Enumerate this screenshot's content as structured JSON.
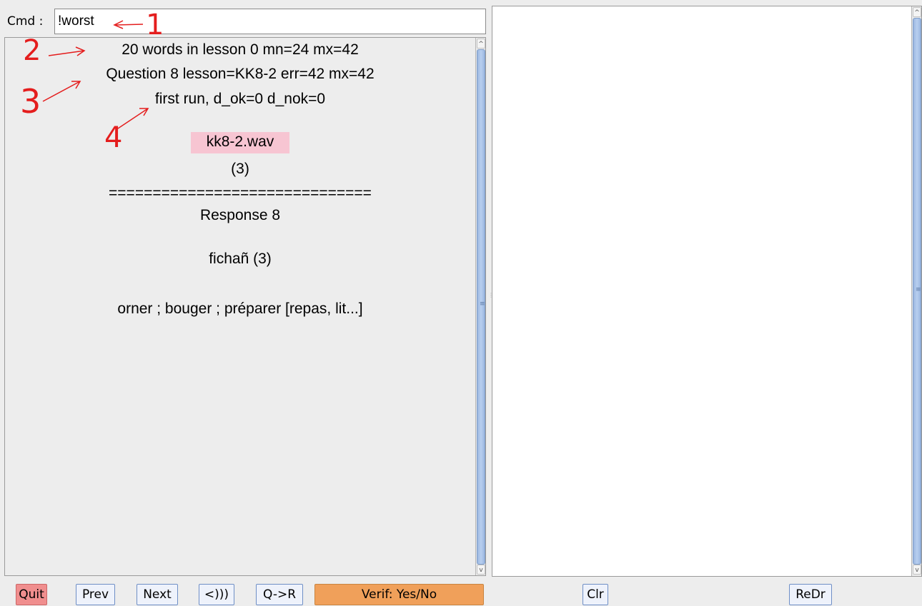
{
  "left": {
    "cmd_label": "Cmd :",
    "cmd_value": "!worst",
    "lesson": {
      "line1": "20  words in lesson  0 mn=24 mx=42",
      "line2": "Question  8   lesson=KK8-2   err=42   mx=42",
      "line3": "first run, d_ok=0   d_nok=0",
      "audio_file": "kk8-2.wav",
      "count_q": "(3)",
      "separator": "==============================",
      "response": "Response  8",
      "word": "fichañ  (3)",
      "meaning": "orner ; bouger ; préparer [repas, lit...]"
    },
    "toolbar": {
      "quit": "Quit",
      "prev": "Prev",
      "next": "Next",
      "play": "<)))",
      "q_to_r": "Q->R",
      "verif": "Verif: Yes/No"
    }
  },
  "right": {
    "toolbar": {
      "clr": "Clr",
      "redr": "ReDr"
    }
  },
  "annotations": {
    "labels": [
      "1",
      "2",
      "3",
      "4"
    ],
    "color": "#e41d1d"
  },
  "colors": {
    "audio_highlight": "#f7c5d2",
    "quit_button": "#f08e8e",
    "verif_button": "#f0a05a",
    "button_border": "#6f8fc6"
  }
}
